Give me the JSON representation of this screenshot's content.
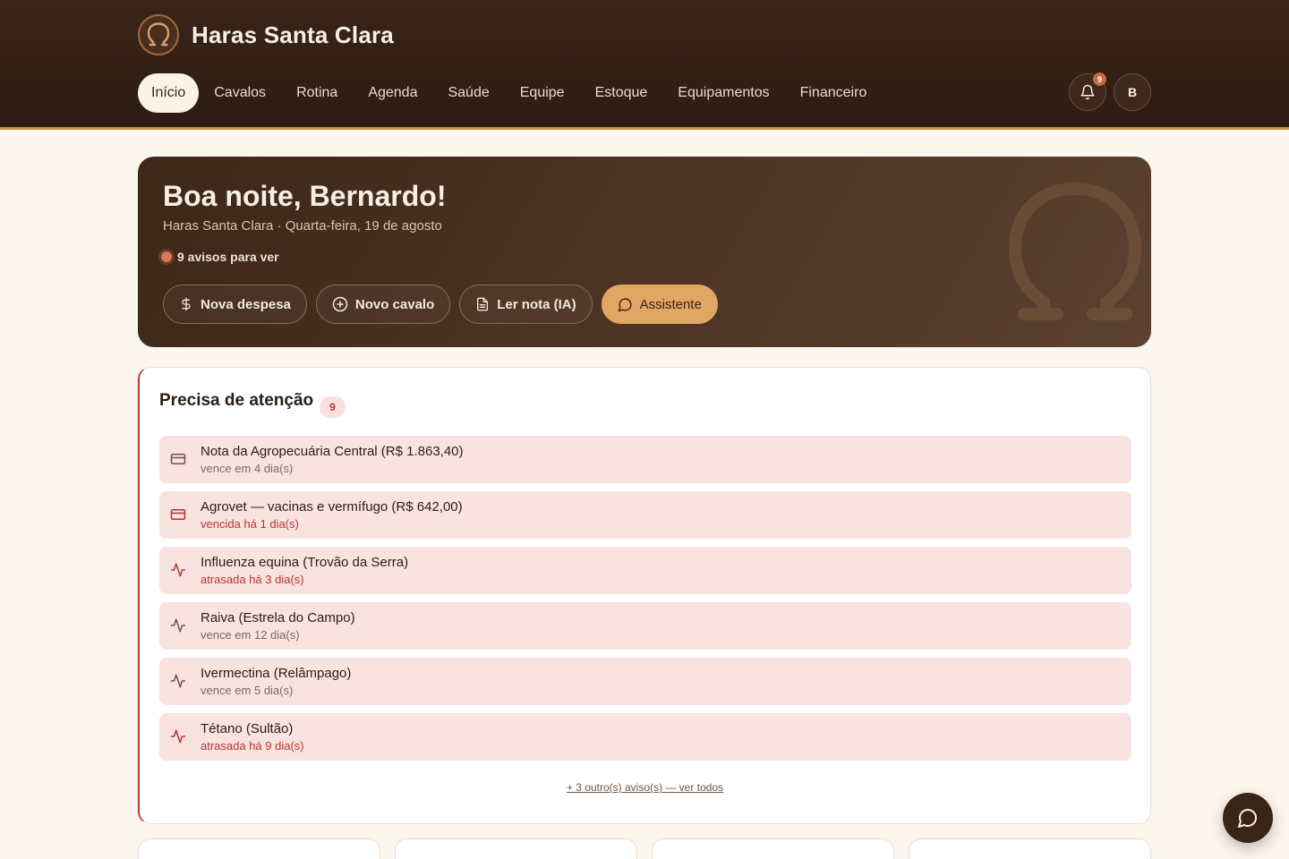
{
  "app": {
    "name": "Haras Santa Clara",
    "logo_icon": "omega-horseshoe-icon"
  },
  "nav": {
    "items": [
      {
        "label": "Início",
        "active": true
      },
      {
        "label": "Cavalos"
      },
      {
        "label": "Rotina"
      },
      {
        "label": "Agenda"
      },
      {
        "label": "Saúde"
      },
      {
        "label": "Equipe"
      },
      {
        "label": "Estoque"
      },
      {
        "label": "Equipamentos"
      },
      {
        "label": "Financeiro"
      }
    ]
  },
  "header_actions": {
    "notifications_count": "9",
    "avatar_initial": "B"
  },
  "hero": {
    "greeting": "Boa noite, Bernardo!",
    "subtitle": "Haras Santa Clara · Quarta-feira, 19 de agosto",
    "alerts_text": "9 avisos para ver",
    "buttons": {
      "new_expense": "Nova despesa",
      "new_horse": "Novo cavalo",
      "read_invoice": "Ler nota (IA)",
      "assistant": "Assistente"
    }
  },
  "attention": {
    "title": "Precisa de atenção",
    "count": "9",
    "items": [
      {
        "icon": "credit-card-icon",
        "title": "Nota da Agropecuária Central (R$ 1.863,40)",
        "sub": "vence em 4 dia(s)",
        "status": "normal"
      },
      {
        "icon": "credit-card-icon",
        "title": "Agrovet — vacinas e vermífugo (R$ 642,00)",
        "sub": "vencida há 1 dia(s)",
        "status": "danger"
      },
      {
        "icon": "activity-icon",
        "title": "Influenza equina (Trovão da Serra)",
        "sub": "atrasada há 3 dia(s)",
        "status": "danger"
      },
      {
        "icon": "activity-icon",
        "title": "Raiva (Estrela do Campo)",
        "sub": "vence em 12 dia(s)",
        "status": "normal"
      },
      {
        "icon": "activity-icon",
        "title": "Ivermectina (Relâmpago)",
        "sub": "vence em 5 dia(s)",
        "status": "normal"
      },
      {
        "icon": "activity-icon",
        "title": "Tétano (Sultão)",
        "sub": "atrasada há 9 dia(s)",
        "status": "danger"
      }
    ],
    "see_all": "+ 3 outro(s) aviso(s) — ver todos"
  },
  "colors": {
    "header_bg": "#3a2418",
    "accent": "#e0a664",
    "danger": "#b5342f",
    "alert_row_bg": "#f8e3e1",
    "page_bg": "#fbf6ee"
  }
}
